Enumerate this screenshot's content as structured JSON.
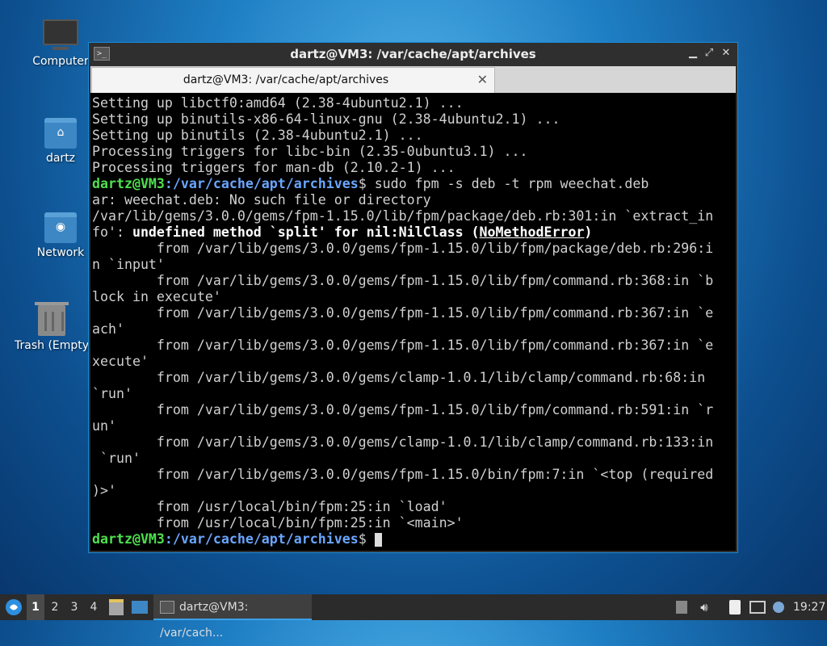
{
  "desktop": {
    "icons": [
      {
        "label": "Computer"
      },
      {
        "label": "dartz"
      },
      {
        "label": "Network"
      },
      {
        "label": "Trash (Empty)"
      }
    ]
  },
  "window": {
    "title": "dartz@VM3: /var/cache/apt/archives",
    "tab_title": "dartz@VM3: /var/cache/apt/archives",
    "controls": {
      "minimize": "▁",
      "maximize": "⤢",
      "close": "✕"
    }
  },
  "terminal": {
    "prompt_user": "dartz@VM3",
    "prompt_path": ":/var/cache/apt/archives",
    "prompt_sym": "$",
    "command": " sudo fpm -s deb -t rpm weechat.deb",
    "lines_before": [
      "Setting up libctf0:amd64 (2.38-4ubuntu2.1) ...",
      "Setting up binutils-x86-64-linux-gnu (2.38-4ubuntu2.1) ...",
      "Setting up binutils (2.38-4ubuntu2.1) ...",
      "Processing triggers for libc-bin (2.35-0ubuntu3.1) ...",
      "Processing triggers for man-db (2.10.2-1) ..."
    ],
    "error_line1": "ar: weechat.deb: No such file or directory",
    "error_line2": "/var/lib/gems/3.0.0/gems/fpm-1.15.0/lib/fpm/package/deb.rb:301:in `extract_in",
    "error_line3_pre": "fo': ",
    "error_line3_bold": "undefined method `split' for nil:NilClass (",
    "error_line3_under": "NoMethodError",
    "error_line3_end": ")",
    "trace": [
      "        from /var/lib/gems/3.0.0/gems/fpm-1.15.0/lib/fpm/package/deb.rb:296:i",
      "n `input'",
      "        from /var/lib/gems/3.0.0/gems/fpm-1.15.0/lib/fpm/command.rb:368:in `b",
      "lock in execute'",
      "        from /var/lib/gems/3.0.0/gems/fpm-1.15.0/lib/fpm/command.rb:367:in `e",
      "ach'",
      "        from /var/lib/gems/3.0.0/gems/fpm-1.15.0/lib/fpm/command.rb:367:in `e",
      "xecute'",
      "        from /var/lib/gems/3.0.0/gems/clamp-1.0.1/lib/clamp/command.rb:68:in",
      "`run'",
      "        from /var/lib/gems/3.0.0/gems/fpm-1.15.0/lib/fpm/command.rb:591:in `r",
      "un'",
      "        from /var/lib/gems/3.0.0/gems/clamp-1.0.1/lib/clamp/command.rb:133:in",
      " `run'",
      "        from /var/lib/gems/3.0.0/gems/fpm-1.15.0/bin/fpm:7:in `<top (required",
      ")>'",
      "        from /usr/local/bin/fpm:25:in `load'",
      "        from /usr/local/bin/fpm:25:in `<main>'"
    ]
  },
  "taskbar": {
    "workspaces": [
      "1",
      "2",
      "3",
      "4"
    ],
    "active_workspace": "1",
    "task_label": "dartz@VM3: /var/cach...",
    "clock": "19:27"
  }
}
